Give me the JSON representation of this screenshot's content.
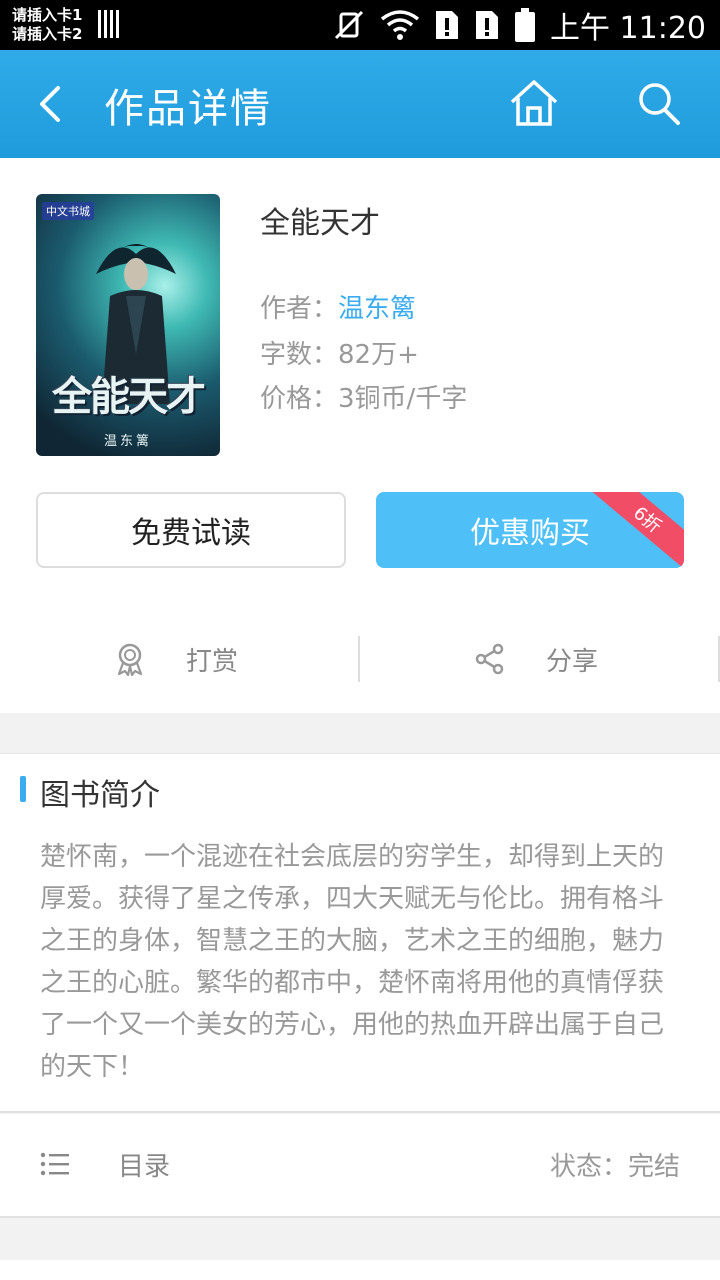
{
  "status_bar": {
    "sim1": "请插入卡1",
    "sim2": "请插入卡2",
    "time": "上午 11:20"
  },
  "header": {
    "title": "作品详情",
    "icons": [
      "back-arrow-icon",
      "home-icon",
      "search-icon"
    ],
    "color": "#2aa6e3"
  },
  "book": {
    "cover_title": "全能天才",
    "cover_author": "温东篱",
    "cover_tag": "中文书城",
    "title": "全能天才",
    "author_label": "作者：",
    "author": "温东篱",
    "words_label": "字数：",
    "words": "82万+",
    "price_label": "价格：",
    "price": "3铜币/千字"
  },
  "buttons": {
    "free_read": "免费试读",
    "buy": "优惠购买",
    "discount": "6折",
    "buy_color": "#4fc0f7",
    "discount_color": "#f24d66"
  },
  "actions": {
    "reward": "打赏",
    "share": "分享"
  },
  "intro": {
    "heading": "图书简介",
    "text": "楚怀南，一个混迹在社会底层的穷学生，却得到上天的厚爱。获得了星之传承，四大天赋无与伦比。拥有格斗之王的身体，智慧之王的大脑，艺术之王的细胞，魅力之王的心脏。繁华的都市中，楚怀南将用他的真情俘获了一个又一个美女的芳心，用他的热血开辟出属于自己的天下！"
  },
  "toc": {
    "label": "目录",
    "status": "状态：完结"
  },
  "accent_color": "#3aacef"
}
